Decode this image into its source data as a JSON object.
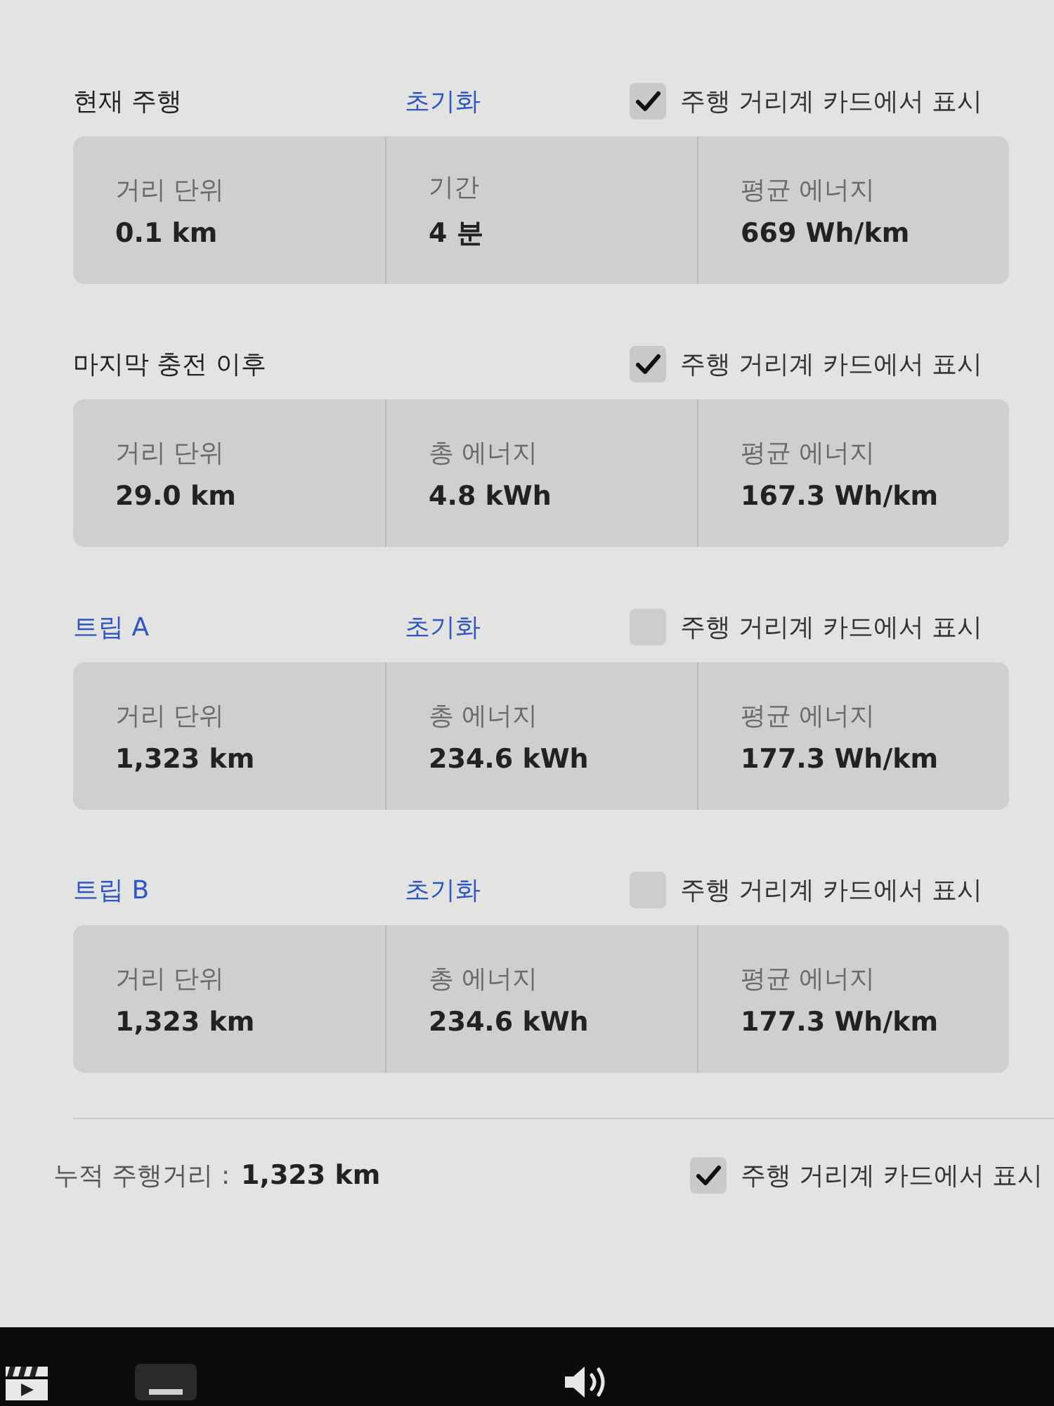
{
  "sections": [
    {
      "title": "현재 주행",
      "title_link": false,
      "reset": "초기화",
      "show_on_card": {
        "label": "주행 거리계 카드에서 표시",
        "checked": true
      },
      "stats": [
        {
          "label": "거리 단위",
          "value": "0.1 km"
        },
        {
          "label": "기간",
          "value": "4 분"
        },
        {
          "label": "평균 에너지",
          "value": "669 Wh/km"
        }
      ]
    },
    {
      "title": "마지막 충전 이후",
      "title_link": false,
      "show_on_card": {
        "label": "주행 거리계 카드에서 표시",
        "checked": true
      },
      "stats": [
        {
          "label": "거리 단위",
          "value": "29.0 km"
        },
        {
          "label": "총 에너지",
          "value": "4.8 kWh"
        },
        {
          "label": "평균 에너지",
          "value": "167.3 Wh/km"
        }
      ]
    },
    {
      "title": "트립 A",
      "title_link": true,
      "reset": "초기화",
      "show_on_card": {
        "label": "주행 거리계 카드에서 표시",
        "checked": false
      },
      "stats": [
        {
          "label": "거리 단위",
          "value": "1,323 km"
        },
        {
          "label": "총 에너지",
          "value": "234.6 kWh"
        },
        {
          "label": "평균 에너지",
          "value": "177.3 Wh/km"
        }
      ]
    },
    {
      "title": "트립 B",
      "title_link": true,
      "reset": "초기화",
      "show_on_card": {
        "label": "주행 거리계 카드에서 표시",
        "checked": false
      },
      "stats": [
        {
          "label": "거리 단위",
          "value": "1,323 km"
        },
        {
          "label": "총 에너지",
          "value": "234.6 kWh"
        },
        {
          "label": "평균 에너지",
          "value": "177.3 Wh/km"
        }
      ]
    }
  ],
  "odometer": {
    "label": "누적 주행거리 :",
    "value": "1,323 km",
    "show_on_card": {
      "label": "주행 거리계 카드에서 표시",
      "checked": true
    }
  }
}
